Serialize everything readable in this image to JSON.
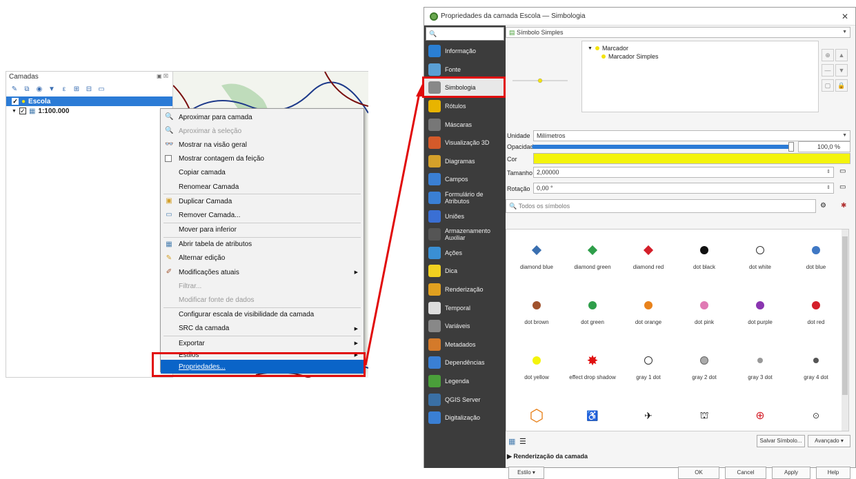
{
  "layers_panel": {
    "title": "Camadas",
    "layers": [
      {
        "name": "Escola",
        "checked": true,
        "selected": true
      },
      {
        "name": "1:100.000",
        "checked": true,
        "selected": false
      }
    ]
  },
  "context_menu": {
    "items": [
      {
        "label": "Aproximar para camada",
        "icon": "zoom-layer-icon",
        "disabled": false
      },
      {
        "label": "Aproximar à seleção",
        "icon": "zoom-selection-icon",
        "disabled": true
      },
      {
        "label": "Mostrar na visão geral",
        "icon": "overview-icon",
        "disabled": false
      },
      {
        "label": "Mostrar contagem da feição",
        "icon": "checkbox-icon",
        "disabled": false
      },
      {
        "label": "Copiar camada",
        "disabled": false
      },
      {
        "label": "Renomear Camada",
        "disabled": false
      },
      {
        "label": "Duplicar Camada",
        "icon": "duplicate-icon",
        "disabled": false
      },
      {
        "label": "Remover Camada...",
        "icon": "remove-icon",
        "disabled": false
      },
      {
        "label": "Mover para inferior",
        "disabled": false
      },
      {
        "label": "Abrir tabela de atributos",
        "icon": "table-icon",
        "disabled": false
      },
      {
        "label": "Alternar edição",
        "icon": "pencil-icon",
        "disabled": false
      },
      {
        "label": "Modificações atuais",
        "icon": "edit-brush-icon",
        "disabled": false,
        "submenu": true
      },
      {
        "label": "Filtrar...",
        "disabled": true
      },
      {
        "label": "Modificar fonte de dados",
        "disabled": true
      },
      {
        "label": "Configurar escala de visibilidade da camada",
        "disabled": false
      },
      {
        "label": "SRC da camada",
        "disabled": false,
        "submenu": true
      },
      {
        "label": "Exportar",
        "disabled": false,
        "submenu": true
      },
      {
        "label": "Estilos",
        "disabled": false,
        "submenu": true
      },
      {
        "label": "Propriedades...",
        "disabled": false,
        "highlighted": true
      }
    ]
  },
  "dialog": {
    "title": "Propriedades da camada   Escola  —  Simbologia",
    "search_placeholder": "",
    "sidebar": [
      {
        "label": "Informação",
        "color": "#2a7fd4"
      },
      {
        "label": "Fonte",
        "color": "#5a9fd4"
      },
      {
        "label": "Simbologia",
        "color": "#888888",
        "selected": true
      },
      {
        "label": "Rótulos",
        "color": "#e8b400"
      },
      {
        "label": "Máscaras",
        "color": "#777777"
      },
      {
        "label": "Visualização 3D",
        "color": "#d45a2a"
      },
      {
        "label": "Diagramas",
        "color": "#d4a02a"
      },
      {
        "label": "Campos",
        "color": "#3a7fd4"
      },
      {
        "label": "Formulário de Atributos",
        "color": "#3a7fd4"
      },
      {
        "label": "Uniões",
        "color": "#3a6fd4"
      },
      {
        "label": "Armazenamento Auxiliar",
        "color": "#555555"
      },
      {
        "label": "Ações",
        "color": "#3a8fd4"
      },
      {
        "label": "Dica",
        "color": "#f0d020"
      },
      {
        "label": "Renderização",
        "color": "#e0a020"
      },
      {
        "label": "Temporal",
        "color": "#dddddd"
      },
      {
        "label": "Variáveis",
        "color": "#888888"
      },
      {
        "label": "Metadados",
        "color": "#d47a2a"
      },
      {
        "label": "Dependências",
        "color": "#3a7fd4"
      },
      {
        "label": "Legenda",
        "color": "#4a9f3a"
      },
      {
        "label": "QGIS Server",
        "color": "#3a6fa4"
      },
      {
        "label": "Digitalização",
        "color": "#3a7fd4"
      }
    ],
    "renderer": "Símbolo Simples",
    "tree": {
      "root": "Marcador",
      "child": "Marcador Simples"
    },
    "unit_label": "Unidade",
    "unit_value": "Milímetros",
    "opacity_label": "Opacidade",
    "opacity_value": "100,0 %",
    "opacity": 1.0,
    "color_label": "Cor",
    "color": "#f4f40c",
    "size_label": "Tamanho",
    "size_value": "2,00000",
    "rotation_label": "Rotação",
    "rotation_value": "0,00 °",
    "symbol_search_placeholder": "Todos os símbolos",
    "symbols": [
      {
        "name": "diamond blue",
        "shape": "diamond",
        "color": "#3a6fb0"
      },
      {
        "name": "diamond green",
        "shape": "diamond",
        "color": "#2e9e4a"
      },
      {
        "name": "diamond red",
        "shape": "diamond",
        "color": "#d41f2a"
      },
      {
        "name": "dot  black",
        "shape": "dot",
        "color": "#111111"
      },
      {
        "name": "dot  white",
        "shape": "ring",
        "color": "#ffffff"
      },
      {
        "name": "dot  blue",
        "shape": "dot",
        "color": "#3f78c4"
      },
      {
        "name": "dot brown",
        "shape": "dot",
        "color": "#a0522d"
      },
      {
        "name": "dot green",
        "shape": "dot",
        "color": "#2e9e4a"
      },
      {
        "name": "dot orange",
        "shape": "dot",
        "color": "#e8821c"
      },
      {
        "name": "dot pink",
        "shape": "dot",
        "color": "#e07ab4"
      },
      {
        "name": "dot  purple",
        "shape": "dot",
        "color": "#8a35b0"
      },
      {
        "name": "dot  red",
        "shape": "dot",
        "color": "#d41f2a"
      },
      {
        "name": "dot yellow",
        "shape": "dot",
        "color": "#f4f40c"
      },
      {
        "name": "effect drop shadow",
        "shape": "star",
        "color": "#e01010"
      },
      {
        "name": "gray  1 dot",
        "shape": "ring",
        "color": "#ffffff"
      },
      {
        "name": "gray 2 dot",
        "shape": "ring-gray",
        "color": "#aaaaaa"
      },
      {
        "name": "gray 3 dot",
        "shape": "dot-small",
        "color": "#999999"
      },
      {
        "name": "gray 4 dot",
        "shape": "dot-small",
        "color": "#555555"
      },
      {
        "name": "",
        "shape": "hexagon",
        "color": "#e8821c"
      },
      {
        "name": "",
        "shape": "accessible",
        "color": "#3a6fa4"
      },
      {
        "name": "",
        "shape": "airport",
        "color": "#111111"
      },
      {
        "name": "",
        "shape": "monument",
        "color": "#111111"
      },
      {
        "name": "",
        "shape": "hospital",
        "color": "#d41f2a"
      },
      {
        "name": "",
        "shape": "target",
        "color": "#333333"
      }
    ],
    "save_symbol_btn": "Salvar Símbolo...",
    "advanced_btn": "Avançado",
    "layer_rendering": "Renderização da camada",
    "style_btn": "Estilo",
    "ok_btn": "OK",
    "cancel_btn": "Cancel",
    "apply_btn": "Apply",
    "help_btn": "Help"
  }
}
